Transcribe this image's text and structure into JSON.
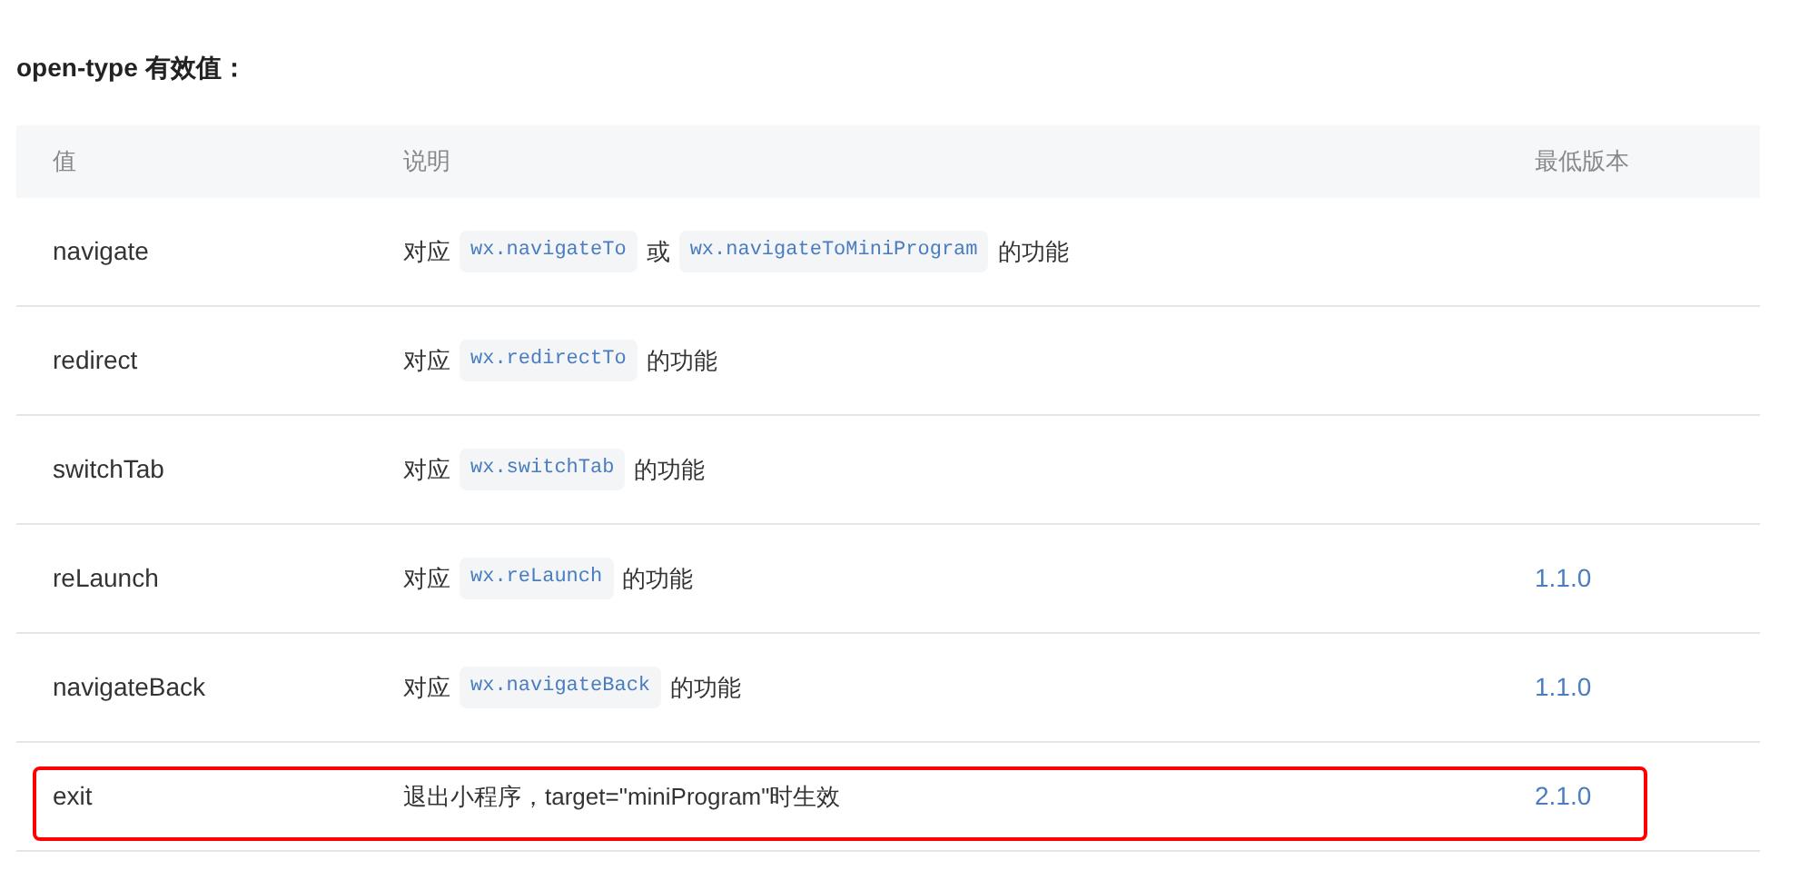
{
  "title": "open-type 有效值：",
  "table": {
    "columns": [
      "值",
      "说明",
      "最低版本"
    ],
    "rows": [
      {
        "value": "navigate",
        "description": [
          {
            "kind": "text",
            "text": "对应"
          },
          {
            "kind": "code",
            "text": "wx.navigateTo"
          },
          {
            "kind": "text",
            "text": "或"
          },
          {
            "kind": "code",
            "text": "wx.navigateToMiniProgram"
          },
          {
            "kind": "text",
            "text": "的功能"
          }
        ],
        "highlighted": false
      },
      {
        "value": "redirect",
        "description": [
          {
            "kind": "text",
            "text": "对应"
          },
          {
            "kind": "code",
            "text": "wx.redirectTo"
          },
          {
            "kind": "text",
            "text": "的功能"
          }
        ],
        "highlighted": false
      },
      {
        "value": "switchTab",
        "description": [
          {
            "kind": "text",
            "text": "对应"
          },
          {
            "kind": "code",
            "text": "wx.switchTab"
          },
          {
            "kind": "text",
            "text": "的功能"
          }
        ],
        "highlighted": false
      },
      {
        "value": "reLaunch",
        "description": [
          {
            "kind": "text",
            "text": "对应"
          },
          {
            "kind": "code",
            "text": "wx.reLaunch"
          },
          {
            "kind": "text",
            "text": "的功能"
          }
        ],
        "version": "1.1.0",
        "highlighted": false
      },
      {
        "value": "navigateBack",
        "description": [
          {
            "kind": "text",
            "text": "对应"
          },
          {
            "kind": "code",
            "text": "wx.navigateBack"
          },
          {
            "kind": "text",
            "text": "的功能"
          }
        ],
        "version": "1.1.0",
        "highlighted": false
      },
      {
        "value": "exit",
        "description": [
          {
            "kind": "text",
            "text": "退出小程序，target=\"miniProgram\"时生效"
          }
        ],
        "version": "2.1.0",
        "highlighted": true
      }
    ]
  }
}
